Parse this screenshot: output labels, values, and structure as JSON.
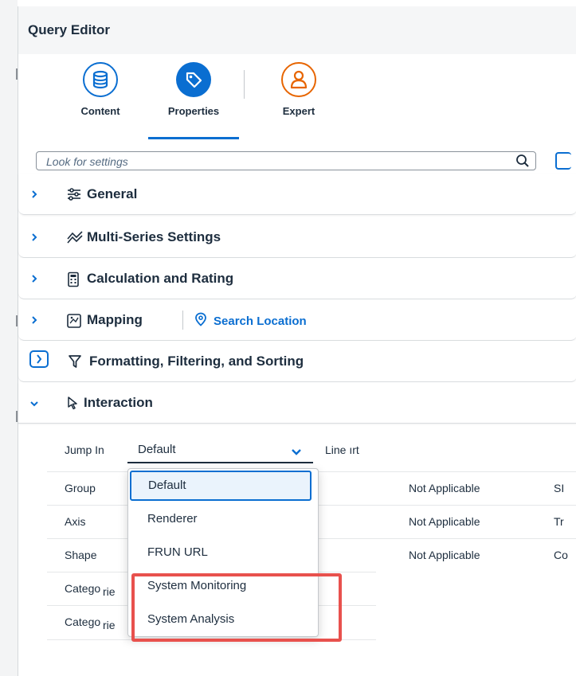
{
  "header": {
    "title": "Query Editor"
  },
  "tabs": [
    {
      "label": "Content",
      "icon": "database-icon",
      "active": false
    },
    {
      "label": "Properties",
      "icon": "tag-icon",
      "active": true
    },
    {
      "label": "Expert",
      "icon": "user-icon",
      "active": false
    }
  ],
  "search": {
    "placeholder": "Look for settings"
  },
  "sections": [
    {
      "label": "General",
      "icon": "sliders-icon",
      "expanded": false
    },
    {
      "label": "Multi-Series Settings",
      "icon": "multi-line-chart-icon",
      "expanded": false
    },
    {
      "label": "Calculation and Rating",
      "icon": "calculator-icon",
      "expanded": false
    },
    {
      "label": "Mapping",
      "icon": "map-icon",
      "expanded": false,
      "action": "Search Location"
    },
    {
      "label": "Formatting, Filtering, and Sorting",
      "icon": "filter-icon",
      "expanded": false
    },
    {
      "label": "Interaction",
      "icon": "cursor-icon",
      "expanded": true
    }
  ],
  "interaction": {
    "jump_label": "Jump In",
    "jump_value": "Default",
    "line_label": "Line",
    "line_label_tail": "ırt",
    "rows": [
      {
        "name": "Group",
        "status": "Not Applicable",
        "extra": "SI"
      },
      {
        "name": "Axis",
        "status": "Not Applicable",
        "extra": "Tr"
      },
      {
        "name": "Shape",
        "status": "Not Applicable",
        "extra": "Co"
      },
      {
        "name": "Catego",
        "tail": "rie",
        "status": "",
        "extra": ""
      },
      {
        "name": "Catego",
        "tail": "rie",
        "status": "",
        "extra": ""
      }
    ],
    "dropdown_options": [
      "Default",
      "Renderer",
      "FRUN URL",
      "System Monitoring",
      "System Analysis"
    ],
    "selected_option": "Default"
  },
  "colors": {
    "accent": "#0a6ed1",
    "expert": "#e76500",
    "highlight": "#e8514d",
    "text": "#1d2d3e"
  }
}
